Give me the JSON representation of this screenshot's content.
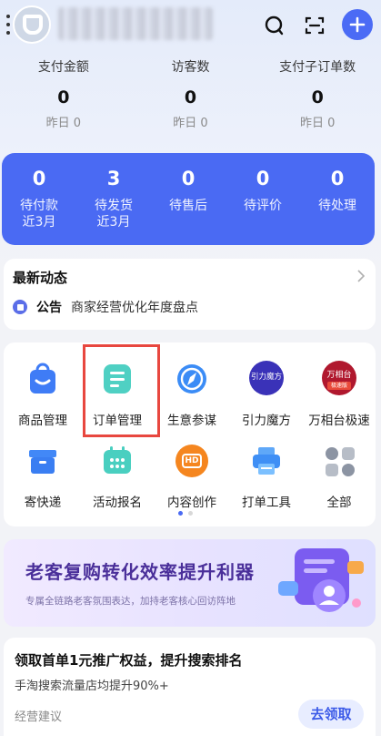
{
  "header": {
    "shop_name": "",
    "accent": "#4b6bf5"
  },
  "stats": [
    {
      "label": "支付金额",
      "value": "0",
      "yesterday": "昨日 0"
    },
    {
      "label": "访客数",
      "value": "0",
      "yesterday": "昨日 0"
    },
    {
      "label": "支付子订单数",
      "value": "0",
      "yesterday": "昨日 0"
    }
  ],
  "order_status": [
    {
      "count": "0",
      "label": "待付款",
      "sub": "近3月"
    },
    {
      "count": "3",
      "label": "待发货",
      "sub": "近3月"
    },
    {
      "count": "0",
      "label": "待售后",
      "sub": ""
    },
    {
      "count": "0",
      "label": "待评价",
      "sub": ""
    },
    {
      "count": "0",
      "label": "待处理",
      "sub": ""
    }
  ],
  "news": {
    "title": "最新动态",
    "tag": "公告",
    "text": "商家经营优化年度盘点"
  },
  "tools": [
    {
      "label": "商品管理",
      "icon": "shopping-bag-icon"
    },
    {
      "label": "订单管理",
      "icon": "order-list-icon"
    },
    {
      "label": "生意参谋",
      "icon": "compass-icon"
    },
    {
      "label": "引力魔方",
      "icon": "yinli-mofang-icon",
      "icon_text": "引力魔方"
    },
    {
      "label": "万相台极速",
      "icon": "wanxiangtai-icon",
      "icon_text": "万相台",
      "icon_badge": "极速版"
    },
    {
      "label": "寄快递",
      "icon": "package-box-icon"
    },
    {
      "label": "活动报名",
      "icon": "activity-icon"
    },
    {
      "label": "内容创作",
      "icon": "hd-video-icon",
      "icon_text": "HD"
    },
    {
      "label": "打单工具",
      "icon": "printer-icon"
    },
    {
      "label": "全部",
      "icon": "all-apps-icon"
    }
  ],
  "banner": {
    "title": "老客复购转化效率提升利器",
    "subtitle": "专属全链路老客氛围表达，加持老客核心回访阵地"
  },
  "promo": {
    "title": "领取首单1元推广权益，提升搜索排名",
    "subtitle": "手淘搜索流量店均提升90%+",
    "footer": "经营建议",
    "button": "去领取"
  }
}
